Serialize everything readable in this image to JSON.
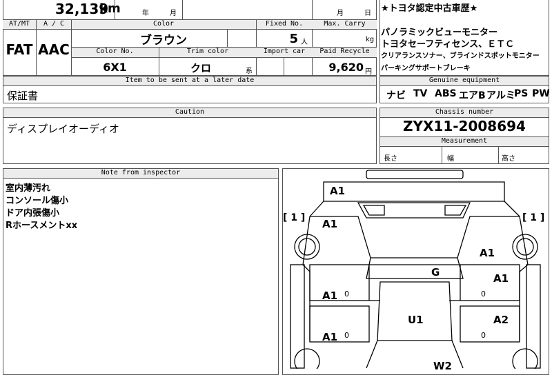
{
  "top": {
    "mileage": "32,139",
    "mileage_unit": "km",
    "year_char": "年",
    "month_char": "月",
    "month_char2": "月",
    "day_char": "日"
  },
  "row_headers": {
    "atmt": "AT/MT",
    "ac": "A / C",
    "color": "Color",
    "fixed_no": "Fixed No.",
    "max_carry": "Max. Carry",
    "color_no": "Color No.",
    "trim_color": "Trim color",
    "import_car": "Import car",
    "paid_recycle": "Paid Recycle"
  },
  "values": {
    "transmission": "FAT",
    "aircon": "AAC",
    "color": "ブラウン",
    "fixed_no": "5",
    "fixed_unit": "人",
    "max_carry_unit": "kg",
    "color_no": "6X1",
    "trim_color": "クロ",
    "trim_suffix": "系",
    "recycle": "9,620",
    "recycle_unit": "円"
  },
  "later": {
    "header": "Item to be sent at a later date",
    "value": "保証書"
  },
  "notes_right": {
    "line1": "★トヨタ認定中古車歴★",
    "line2": "パノラミックビューモニター",
    "line3": "トヨタセーフティセンス、ＥＴＣ",
    "line4": "クリアランスソナー、ブラインドスポットモニター",
    "line5": "パーキングサポートブレーキ"
  },
  "equipment": {
    "header": "Genuine equipment",
    "items": [
      "ナビ",
      "TV",
      "ABS",
      "エアB",
      "アルミ",
      "PS",
      "PW"
    ]
  },
  "caution": {
    "header": "Caution",
    "value": "ディスプレイオーディオ"
  },
  "chassis": {
    "header": "Chassis number",
    "value": "ZYX11-2008694"
  },
  "measurement": {
    "header": "Measurement",
    "length": "長さ",
    "width": "幅",
    "height": "高さ"
  },
  "inspector": {
    "header": "Note from inspector",
    "lines": [
      "室内薄汚れ",
      "コンソール傷小",
      "ドア内張傷小",
      "Rホースメントxx"
    ]
  },
  "diagram": {
    "marks": {
      "roof_front": "A1",
      "left_fender": "A1",
      "right_fender": "A1",
      "hood": "G",
      "right_door_front": "A1",
      "left_door_front": "A1",
      "roof": "U1",
      "right_door_rear": "A2",
      "left_door_rear": "A1",
      "rear": "W2",
      "left_bracket": "[ 1 ]",
      "right_bracket": "[ 1 ]",
      "mini_left_1": "0",
      "mini_left_2": "0",
      "mini_right_1": "0",
      "mini_right_2": "0"
    }
  }
}
